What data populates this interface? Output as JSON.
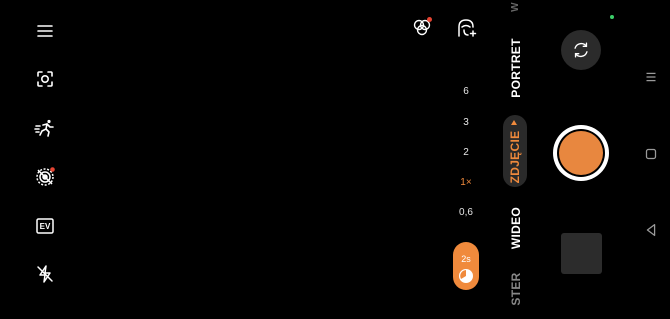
{
  "left_toolbar": [
    {
      "name": "menu-icon"
    },
    {
      "name": "focus-icon"
    },
    {
      "name": "motion-icon"
    },
    {
      "name": "live-photo-off-icon"
    },
    {
      "name": "ev-icon",
      "label": "EV"
    },
    {
      "name": "flash-off-icon"
    }
  ],
  "top_icons": [
    {
      "name": "filters-icon"
    },
    {
      "name": "beauty-icon"
    }
  ],
  "zoom_levels": [
    "6",
    "3",
    "2",
    "1×",
    "0,6"
  ],
  "zoom_active": "1×",
  "timer": {
    "label": "2s"
  },
  "modes": {
    "partial_top": "W",
    "portrait": "PORTRET",
    "photo": "ZDJĘCIE",
    "video": "WIDEO",
    "partial_bottom": "STER"
  },
  "colors": {
    "accent": "#f08a3c",
    "shutter": "#e8873f",
    "notification_dot": "#e64533",
    "status_dot": "#3ccf6a"
  }
}
